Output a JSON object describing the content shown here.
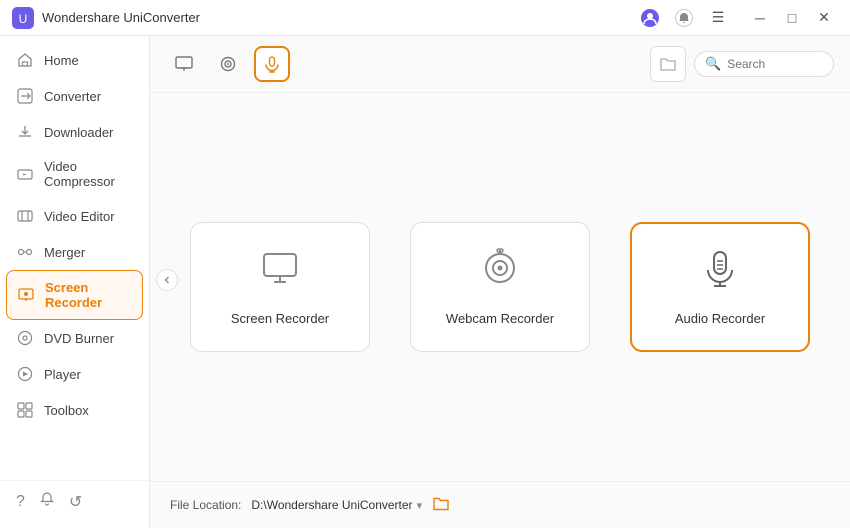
{
  "app": {
    "title": "Wondershare UniConverter",
    "logo_unicode": "🎬"
  },
  "titlebar": {
    "user_icon": "👤",
    "notification_icon": "🔔",
    "menu_icon": "☰",
    "minimize_label": "─",
    "maximize_label": "□",
    "close_label": "✕"
  },
  "sidebar": {
    "items": [
      {
        "id": "home",
        "label": "Home",
        "icon": "⌂",
        "active": false
      },
      {
        "id": "converter",
        "label": "Converter",
        "icon": "🖥",
        "active": false
      },
      {
        "id": "downloader",
        "label": "Downloader",
        "icon": "⬇",
        "active": false
      },
      {
        "id": "video-compressor",
        "label": "Video Compressor",
        "icon": "🗜",
        "active": false
      },
      {
        "id": "video-editor",
        "label": "Video Editor",
        "icon": "✂",
        "active": false
      },
      {
        "id": "merger",
        "label": "Merger",
        "icon": "➕",
        "active": false
      },
      {
        "id": "screen-recorder",
        "label": "Screen Recorder",
        "icon": "▶",
        "active": true
      },
      {
        "id": "dvd-burner",
        "label": "DVD Burner",
        "icon": "💿",
        "active": false
      },
      {
        "id": "player",
        "label": "Player",
        "icon": "▷",
        "active": false
      },
      {
        "id": "toolbox",
        "label": "Toolbox",
        "icon": "⚙",
        "active": false
      }
    ],
    "bottom_icons": [
      "?",
      "🔔",
      "↺"
    ]
  },
  "topbar": {
    "tabs": [
      {
        "id": "screen",
        "icon": "🖥",
        "active": false,
        "label": "Screen"
      },
      {
        "id": "webcam",
        "icon": "⊙",
        "active": false,
        "label": "Webcam"
      },
      {
        "id": "audio",
        "icon": "🎙",
        "active": true,
        "label": "Audio"
      }
    ],
    "search_placeholder": "Search"
  },
  "recorder_cards": [
    {
      "id": "screen-recorder",
      "label": "Screen Recorder",
      "icon": "🖥"
    },
    {
      "id": "webcam-recorder",
      "label": "Webcam Recorder",
      "icon": "📷"
    },
    {
      "id": "audio-recorder",
      "label": "Audio Recorder",
      "icon": "🎙",
      "active": true
    }
  ],
  "footer": {
    "label": "File Location:",
    "path": "D:\\Wondershare UniConverter",
    "dropdown_icon": "▾"
  },
  "colors": {
    "accent": "#e8820c",
    "active_bg": "#fff7f0"
  }
}
